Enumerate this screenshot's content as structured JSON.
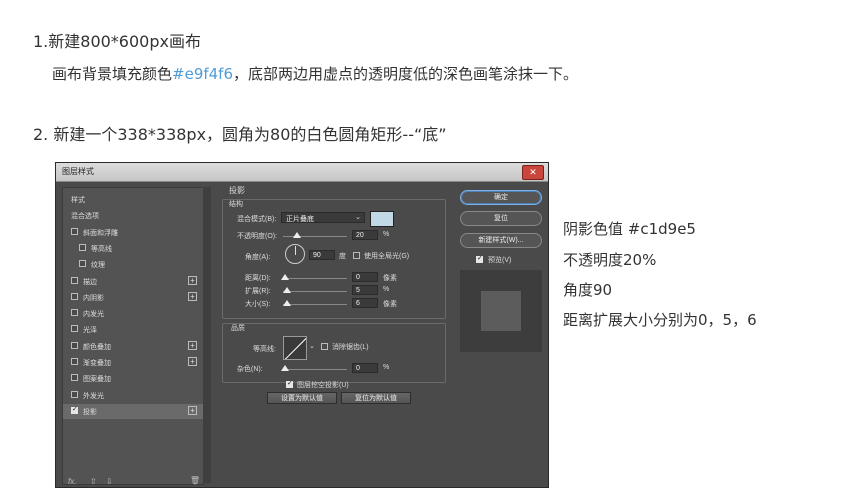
{
  "tutorial": {
    "step1": "1.新建800*600px画布",
    "line2_prefix": "画布背景填充颜色",
    "line2_hex": "#e9f4f6",
    "line2_suffix": "，底部两边用虚点的透明度低的深色画笔涂抹一下。",
    "step2": "2. 新建一个338*338px，圆角为80的白色圆角矩形--“底”"
  },
  "dialog": {
    "title": "图层样式",
    "close": "✕",
    "left_items": [
      {
        "label": "样式",
        "checkbox": false,
        "checked": false,
        "plus": false,
        "indent": 0
      },
      {
        "label": "混合选项",
        "checkbox": false,
        "checked": false,
        "plus": false,
        "indent": 0
      },
      {
        "label": "斜面和浮雕",
        "checkbox": true,
        "checked": false,
        "plus": false,
        "indent": 0
      },
      {
        "label": "等高线",
        "checkbox": true,
        "checked": false,
        "plus": false,
        "indent": 1
      },
      {
        "label": "纹理",
        "checkbox": true,
        "checked": false,
        "plus": false,
        "indent": 1
      },
      {
        "label": "描边",
        "checkbox": true,
        "checked": false,
        "plus": true,
        "indent": 0
      },
      {
        "label": "内阴影",
        "checkbox": true,
        "checked": false,
        "plus": true,
        "indent": 0
      },
      {
        "label": "内发光",
        "checkbox": true,
        "checked": false,
        "plus": false,
        "indent": 0
      },
      {
        "label": "光泽",
        "checkbox": true,
        "checked": false,
        "plus": false,
        "indent": 0
      },
      {
        "label": "颜色叠加",
        "checkbox": true,
        "checked": false,
        "plus": true,
        "indent": 0
      },
      {
        "label": "渐变叠加",
        "checkbox": true,
        "checked": false,
        "plus": true,
        "indent": 0
      },
      {
        "label": "图案叠加",
        "checkbox": true,
        "checked": false,
        "plus": false,
        "indent": 0
      },
      {
        "label": "外发光",
        "checkbox": true,
        "checked": false,
        "plus": false,
        "indent": 0
      },
      {
        "label": "投影",
        "checkbox": true,
        "checked": true,
        "plus": true,
        "indent": 0
      }
    ],
    "footer_fx": "fx.",
    "section_title": "投影",
    "structure_title": "结构",
    "blend_mode_label": "混合模式(B):",
    "blend_mode_value": "正片叠底",
    "shadow_color": "#c1d9e5",
    "opacity_label": "不透明度(O):",
    "opacity_value": "20",
    "angle_label": "角度(A):",
    "angle_value": "90",
    "degree_unit": "度",
    "global_light_label": "使用全局光(G)",
    "distance_label": "距离(D):",
    "distance_value": "0",
    "spread_label": "扩展(R):",
    "spread_value": "5",
    "size_label": "大小(S):",
    "size_value": "6",
    "px_unit": "像素",
    "percent_unit": "%",
    "quality_title": "品质",
    "contour_label": "等高线:",
    "antialias_label": "消除锯齿(L)",
    "noise_label": "杂色(N):",
    "noise_value": "0",
    "knockout_label": "图层挖空投影(U)",
    "make_default": "设置为默认值",
    "reset_default": "复位为默认值",
    "ok": "确定",
    "reset": "复位",
    "new_style": "新建样式(W)...",
    "preview_label": "预览(V)"
  },
  "notes": [
    "阴影色值 #c1d9e5",
    "不透明度20%",
    "角度90",
    "距离扩展大小分别为0，5，6"
  ]
}
